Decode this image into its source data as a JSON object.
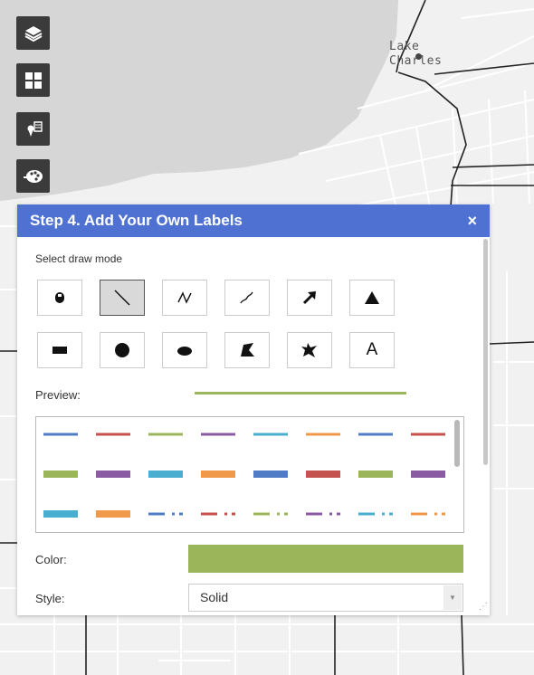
{
  "map": {
    "place_label_line1": "Lake",
    "place_label_line2": "Charles"
  },
  "toolbar": [
    {
      "name": "layers-button",
      "icon": "layers-icon"
    },
    {
      "name": "basemap-gallery-button",
      "icon": "grid-icon"
    },
    {
      "name": "legend-button",
      "icon": "map-pin-icon"
    },
    {
      "name": "draw-button",
      "icon": "palette-icon"
    }
  ],
  "panel": {
    "title": "Step 4. Add Your Own Labels",
    "close_symbol": "×",
    "draw_mode_label": "Select draw mode",
    "preview_label": "Preview:",
    "color_label": "Color:",
    "style_label": "Style:",
    "style_value": "Solid",
    "selected_color": "#9ab55a",
    "text_mode_glyph": "A",
    "draw_modes": [
      "point",
      "line",
      "polyline",
      "freehand-polyline",
      "arrow",
      "triangle",
      "rectangle",
      "circle",
      "ellipse",
      "polygon",
      "freehand-polygon",
      "text"
    ],
    "selected_mode": "line"
  },
  "swatches": {
    "colors": [
      "#4f7cc4",
      "#c4524f",
      "#9ab55a",
      "#8a5ba3",
      "#4aaed0",
      "#f0994a"
    ],
    "rows": [
      {
        "style": "solid-thin",
        "colors": [
          "#4f7cc4",
          "#c4524f",
          "#9ab55a",
          "#8a5ba3",
          "#4aaed0",
          "#f0994a",
          "#4f7cc4",
          "#c4524f"
        ]
      },
      {
        "style": "solid-thick",
        "colors": [
          "#9ab55a",
          "#8a5ba3",
          "#4aaed0",
          "#f0994a",
          "#4f7cc4",
          "#c4524f",
          "#9ab55a",
          "#8a5ba3"
        ]
      },
      {
        "style": "mixed",
        "colors": [
          "#4aaed0",
          "#f0994a",
          "#4f7cc4",
          "#c4524f",
          "#9ab55a",
          "#8a5ba3",
          "#4aaed0",
          "#f0994a"
        ]
      }
    ]
  }
}
